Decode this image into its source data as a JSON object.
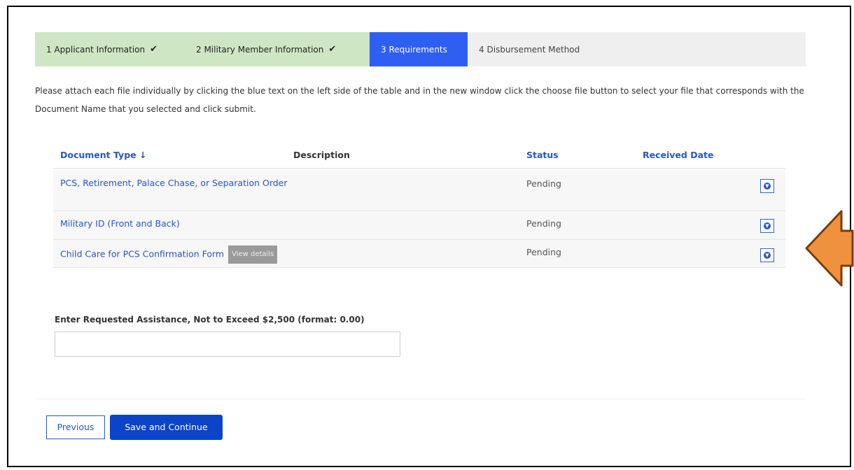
{
  "steps": [
    {
      "label": "1 Applicant Information",
      "state": "done"
    },
    {
      "label": "2 Military Member Information",
      "state": "done"
    },
    {
      "label": "3 Requirements",
      "state": "active"
    },
    {
      "label": "4 Disbursement Method",
      "state": "todo"
    }
  ],
  "check_glyph": "✔",
  "instructions": "Please attach each file individually by clicking the blue text on the left side of the table and in the new window click the choose file button to select your file that corresponds with the Document Name that you selected and click submit.",
  "table": {
    "headers": {
      "doc_type": "Document Type ↓",
      "description": "Description",
      "status": "Status",
      "received": "Received Date"
    },
    "rows": [
      {
        "doc": "PCS, Retirement, Palace Chase, or Separation Order",
        "description": "",
        "status": "Pending",
        "received": ""
      },
      {
        "doc": "Military ID (Front and Back)",
        "description": "",
        "status": "Pending",
        "received": ""
      },
      {
        "doc": "Child Care for PCS Confirmation Form",
        "badge": "View details",
        "description": "",
        "status": "Pending",
        "received": ""
      }
    ]
  },
  "amount": {
    "label": "Enter Requested Assistance, Not to Exceed $2,500 (format: 0.00)",
    "value": ""
  },
  "buttons": {
    "previous": "Previous",
    "save": "Save and Continue"
  },
  "colors": {
    "accent": "#2f5ff2",
    "done_step": "#cfe6c4",
    "arrow_fill": "#f0923d",
    "arrow_stroke": "#7a3d0a"
  },
  "icons": {
    "expand": "chevron-down-circle-icon",
    "callout": "left-arrow-callout-icon"
  }
}
